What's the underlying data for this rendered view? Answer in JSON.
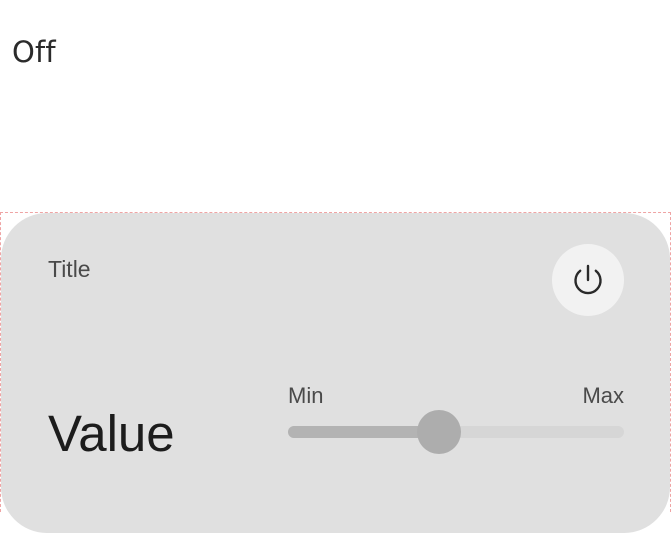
{
  "state_label": "Off",
  "card": {
    "title": "Title",
    "value": "Value",
    "power_button": {
      "icon": "power-icon"
    },
    "slider": {
      "min_label": "Min",
      "max_label": "Max",
      "level": 0.45
    }
  },
  "colors": {
    "card_background": "#e0e0e0",
    "power_button_background": "#f2f2f2",
    "slider_track": "#d6d6d6",
    "slider_fill": "#b3b3b3",
    "slider_thumb": "#adadad"
  }
}
